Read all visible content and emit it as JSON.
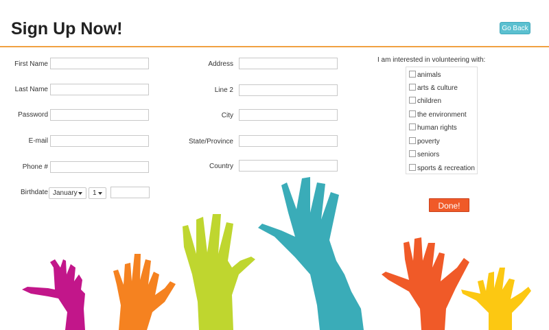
{
  "header": {
    "title": "Sign Up Now!",
    "back_label": "Go Back"
  },
  "form": {
    "first_name_label": "First Name",
    "last_name_label": "Last Name",
    "password_label": "Password",
    "email_label": "E-mail",
    "phone_label": "Phone #",
    "birthdate_label": "Birthdate",
    "birth_month": "January",
    "birth_day": "1",
    "birth_year": "",
    "address_label": "Address",
    "line2_label": "Line 2",
    "city_label": "City",
    "state_label": "State/Province",
    "country_label": "Country"
  },
  "interests": {
    "title": "I am interested in volunteering with:",
    "items": [
      "animals",
      "arts & culture",
      "children",
      "the environment",
      "human rights",
      "poverty",
      "seniors",
      "sports & recreation"
    ]
  },
  "done_label": "Done!",
  "colors": {
    "accent_line": "#f0a040",
    "back_button": "#5bc0d0",
    "done_button": "#f05a28",
    "hand_magenta": "#c2168a",
    "hand_orange": "#f58220",
    "hand_lime": "#bfd62f",
    "hand_teal": "#3aacb8",
    "hand_red_orange": "#f05a28",
    "hand_yellow": "#fcc812"
  }
}
